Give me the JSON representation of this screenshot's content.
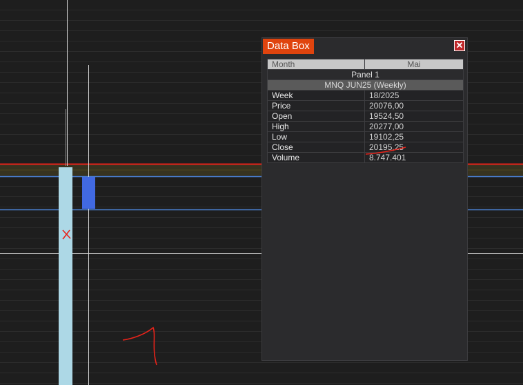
{
  "data_box": {
    "title": "Data Box",
    "close_icon": "close-icon",
    "header": {
      "col1": "Month",
      "col2": "Mai"
    },
    "panel": "Panel 1",
    "symbol": "MNQ JUN25 (Weekly)",
    "rows": [
      {
        "label": "Week",
        "value": "18/2025"
      },
      {
        "label": "Price",
        "value": "20076,00"
      },
      {
        "label": "Open",
        "value": "19524,50"
      },
      {
        "label": "High",
        "value": "20277,00"
      },
      {
        "label": "Low",
        "value": "19102,25"
      },
      {
        "label": "Close",
        "value": "20195,25"
      },
      {
        "label": "Volume",
        "value": "8.747.401"
      }
    ]
  },
  "annotations": {
    "x_mark": "x",
    "one_mark": "1"
  },
  "colors": {
    "background": "#1e1e1e",
    "red_line": "#e8231a",
    "blue_line": "#4c83d8",
    "volume_bar": "#add8e6",
    "candle": "#4169e1",
    "title_accent": "#e0440e"
  }
}
